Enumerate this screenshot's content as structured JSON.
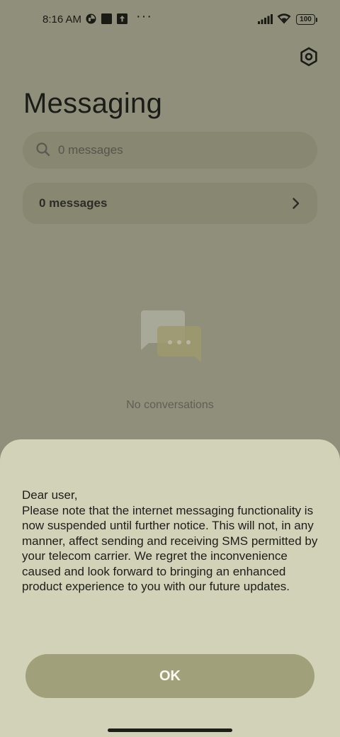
{
  "status_bar": {
    "time": "8:16 AM",
    "overflow": "···",
    "battery": "100",
    "icons": [
      "app-badge-icon",
      "square-notification-icon",
      "upload-notification-icon",
      "signal-icon",
      "wifi-icon",
      "battery-icon"
    ]
  },
  "header": {
    "title": "Messaging",
    "settings_icon": "settings-hexagon-icon"
  },
  "search": {
    "placeholder": "0 messages",
    "icon": "search-icon"
  },
  "messages_row": {
    "label": "0 messages",
    "icon": "chevron-right-icon"
  },
  "empty_state": {
    "text": "No conversations",
    "icon": "chat-bubbles-icon"
  },
  "dialog": {
    "lines": [
      "Dear user,",
      "Please note that the internet messaging functionality is now suspended until further notice. This will not, in any manner, affect sending and receiving SMS permitted by your telecom carrier. We regret the inconvenience caused and look forward to bringing an enhanced product experience to you with our future updates."
    ],
    "ok_label": "OK"
  },
  "colors": {
    "background_dimmed": "#8f8f7b",
    "sheet": "#d2d2b9",
    "button": "#a0a07a"
  }
}
